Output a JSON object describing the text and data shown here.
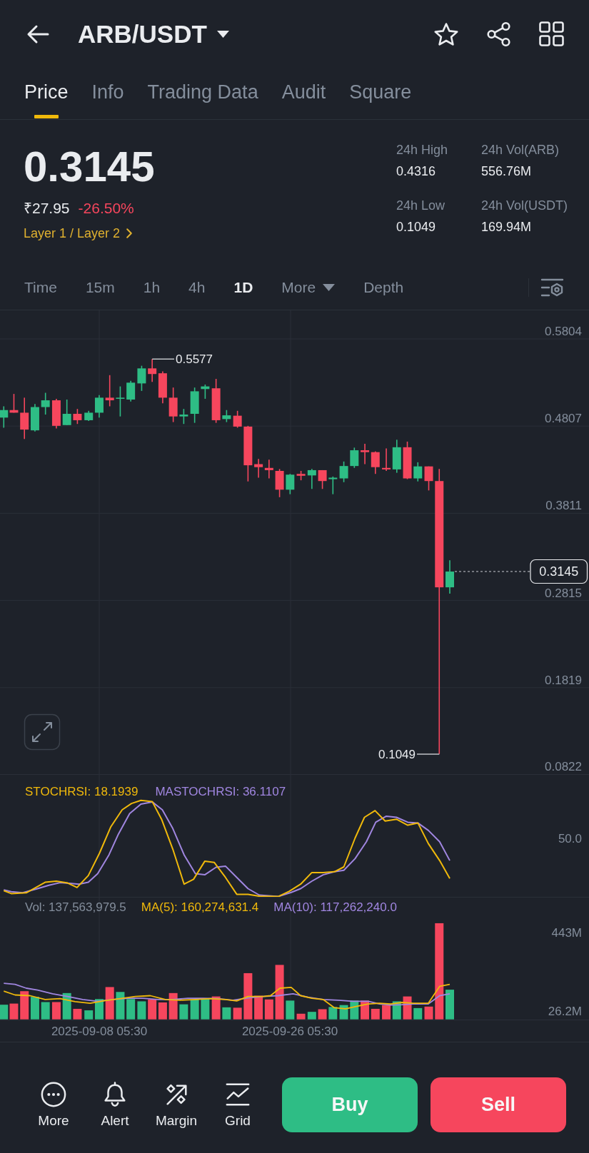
{
  "header": {
    "title": "ARB/USDT"
  },
  "tabs": [
    {
      "label": "Price",
      "selected": true
    },
    {
      "label": "Info",
      "selected": false
    },
    {
      "label": "Trading Data",
      "selected": false
    },
    {
      "label": "Audit",
      "selected": false
    },
    {
      "label": "Square",
      "selected": false
    }
  ],
  "ticker": {
    "last_price": "0.3145",
    "fiat_price": "₹27.95",
    "change": "-26.50%",
    "category": "Layer 1 / Layer 2",
    "stats": [
      {
        "label": "24h High",
        "value": "0.4316"
      },
      {
        "label": "24h Vol(ARB)",
        "value": "556.76M"
      },
      {
        "label": "24h Low",
        "value": "0.1049"
      },
      {
        "label": "24h Vol(USDT)",
        "value": "169.94M"
      }
    ]
  },
  "intervals": [
    {
      "label": "Time",
      "kind": "option",
      "selected": false
    },
    {
      "label": "15m",
      "kind": "option",
      "selected": false
    },
    {
      "label": "1h",
      "kind": "option",
      "selected": false
    },
    {
      "label": "4h",
      "kind": "option",
      "selected": false
    },
    {
      "label": "1D",
      "kind": "option",
      "selected": true
    },
    {
      "label": "More",
      "kind": "menu",
      "selected": false
    },
    {
      "label": "Depth",
      "kind": "option",
      "selected": false
    }
  ],
  "price_chart": {
    "axis_labels": [
      "0.5804",
      "0.4807",
      "0.3811",
      "0.2815",
      "0.1819",
      "0.0822"
    ],
    "high_label": "0.5577",
    "low_label": "0.1049",
    "last_price_tag": "0.3145"
  },
  "stoch_rsi": {
    "legend": [
      {
        "label": "STOCHRSI: 18.1939",
        "color": "#f0b90b"
      },
      {
        "label": "MASTOCHRSI: 36.1107",
        "color": "#a086e0"
      }
    ],
    "axis_labels": [
      "50.0"
    ]
  },
  "volume": {
    "legend": [
      {
        "label": "Vol: 137,563,979.5",
        "color": "#848e9c"
      },
      {
        "label": "MA(5): 160,274,631.4",
        "color": "#f0b90b"
      },
      {
        "label": "MA(10): 117,262,240.0",
        "color": "#a086e0"
      }
    ],
    "axis_labels": [
      "443M",
      "26.2M"
    ]
  },
  "time_axis": [
    "2025-09-08 05:30",
    "2025-09-26 05:30"
  ],
  "bottom_bar": {
    "actions": [
      {
        "label": "More"
      },
      {
        "label": "Alert"
      },
      {
        "label": "Margin"
      },
      {
        "label": "Grid"
      }
    ],
    "trade_buttons": [
      {
        "label": "Buy",
        "kind": "buy"
      },
      {
        "label": "Sell",
        "kind": "sell"
      }
    ]
  }
}
